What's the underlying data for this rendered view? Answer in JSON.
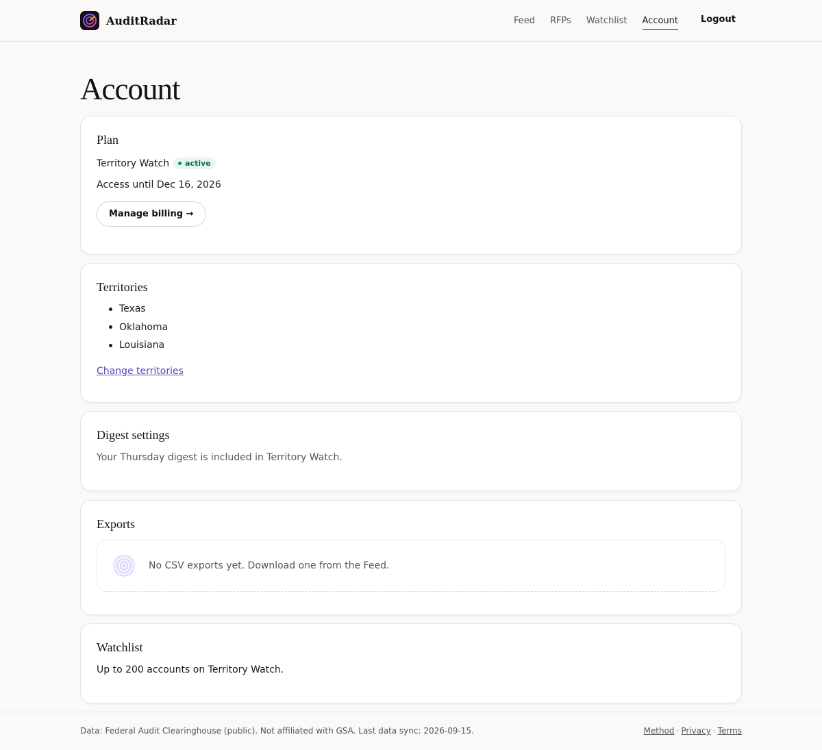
{
  "header": {
    "brand": "AuditRadar",
    "nav": [
      "Feed",
      "RFPs",
      "Watchlist",
      "Account"
    ],
    "active_nav": "Account",
    "logout": "Logout"
  },
  "page": {
    "title": "Account"
  },
  "plan": {
    "title": "Plan",
    "name": "Territory Watch",
    "status": "active",
    "access": "Access until Dec 16, 2026",
    "button": "Manage billing →"
  },
  "territories": {
    "title": "Territories",
    "items": [
      "Texas",
      "Oklahoma",
      "Louisiana"
    ],
    "link": "Change territories"
  },
  "digest": {
    "title": "Digest settings",
    "text": "Your Thursday digest is included in Territory Watch."
  },
  "exports": {
    "title": "Exports",
    "empty": "No CSV exports yet. Download one from the Feed."
  },
  "watchlist": {
    "title": "Watchlist",
    "text": "Up to 200 accounts on Territory Watch."
  },
  "footer": {
    "note": "Data: Federal Audit Clearinghouse (public). Not affiliated with GSA. Last data sync: 2026-09-15.",
    "links": [
      "Method",
      "Privacy",
      "Terms"
    ]
  },
  "colors": {
    "accent": "#5b46b8",
    "badge_bg": "#e6f6ee",
    "badge_text": "#127049",
    "background": "#faf9f7"
  }
}
